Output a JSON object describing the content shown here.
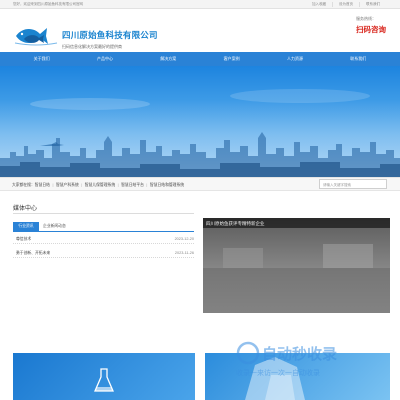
{
  "topbar": {
    "welcome": "您好，欢迎来到四川原始鱼科技有限公司官网",
    "links": [
      "加入收藏",
      "设为首页",
      "联系我们"
    ]
  },
  "header": {
    "brand": "四川原始鱼科技有限公司",
    "slogan": "扫码信息化解决方案最好的提供商",
    "hotline_label": "服务热线：",
    "qr_text": "扫码咨询"
  },
  "nav": [
    "关于我们",
    "产品中心",
    "解决方案",
    "客户案例",
    "人力资源",
    "联系我们"
  ],
  "breadcrumb": [
    "大家都在搜：",
    "智慧日结",
    "智慧产科系统",
    "智慧儿保管理系统",
    "智慧日结平台",
    "智慧日结和管理系统"
  ],
  "search": {
    "placeholder": "请输入关键字搜索"
  },
  "media": {
    "title": "媒体中心",
    "tabs": [
      "行业资讯",
      "企业新闻动态"
    ],
    "rows": [
      {
        "title": "尊信技术",
        "date": "2023-12-20"
      },
      {
        "title": "勇于创新、开拓未来",
        "date": "2023-11-26"
      }
    ],
    "feature_caption": "四川原始鱼获评专精特新企业"
  },
  "colors": {
    "primary": "#2a82d6",
    "brand": "#1b84cf",
    "accent": "#d8231a"
  },
  "watermark": {
    "line1": "自动秒收录",
    "line2": "收录一来访一次一自动收录"
  }
}
